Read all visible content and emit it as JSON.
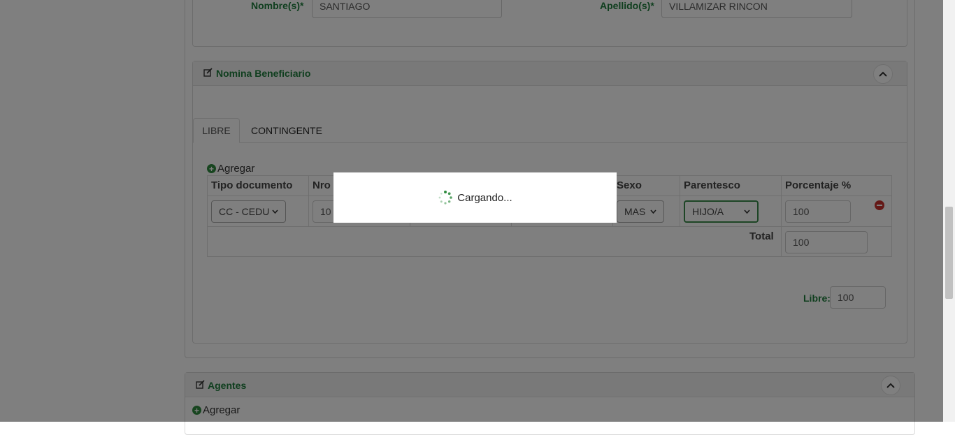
{
  "personal": {
    "nombre_label": "Nombre(s)*",
    "nombre_value": "SANTIAGO",
    "apellido_label": "Apellido(s)*",
    "apellido_value": "VILLAMIZAR RINCON"
  },
  "beneficiario_panel": {
    "title": "Nomina Beneficiario",
    "tabs": [
      {
        "label": "LIBRE",
        "active": true
      },
      {
        "label": "CONTINGENTE",
        "active": false
      }
    ],
    "add_label": "Agregar",
    "columns": [
      "Tipo documento",
      "Nro",
      "Sexo",
      "Parentesco",
      "Porcentaje %"
    ],
    "row": {
      "tipo_documento": "CC - CEDU",
      "nro": "10",
      "sexo": "MAS",
      "parentesco": "HIJO/A",
      "porcentaje": "100"
    },
    "total_label": "Total",
    "total_value": "100",
    "libre_label": "Libre:",
    "libre_value": "100"
  },
  "agentes_panel": {
    "title": "Agentes",
    "add_label": "Agregar"
  },
  "loading": {
    "text": "Cargando..."
  },
  "icons": {
    "edit": "edit-icon",
    "chevron_up": "chevron-up-icon",
    "plus": "plus-circle-icon",
    "remove": "minus-circle-icon",
    "spinner": "spinner-icon"
  },
  "colors": {
    "accent_green": "#1e7d3c",
    "remove_red": "#c9302c",
    "overlay": "rgba(0,0,0,0.5)"
  }
}
